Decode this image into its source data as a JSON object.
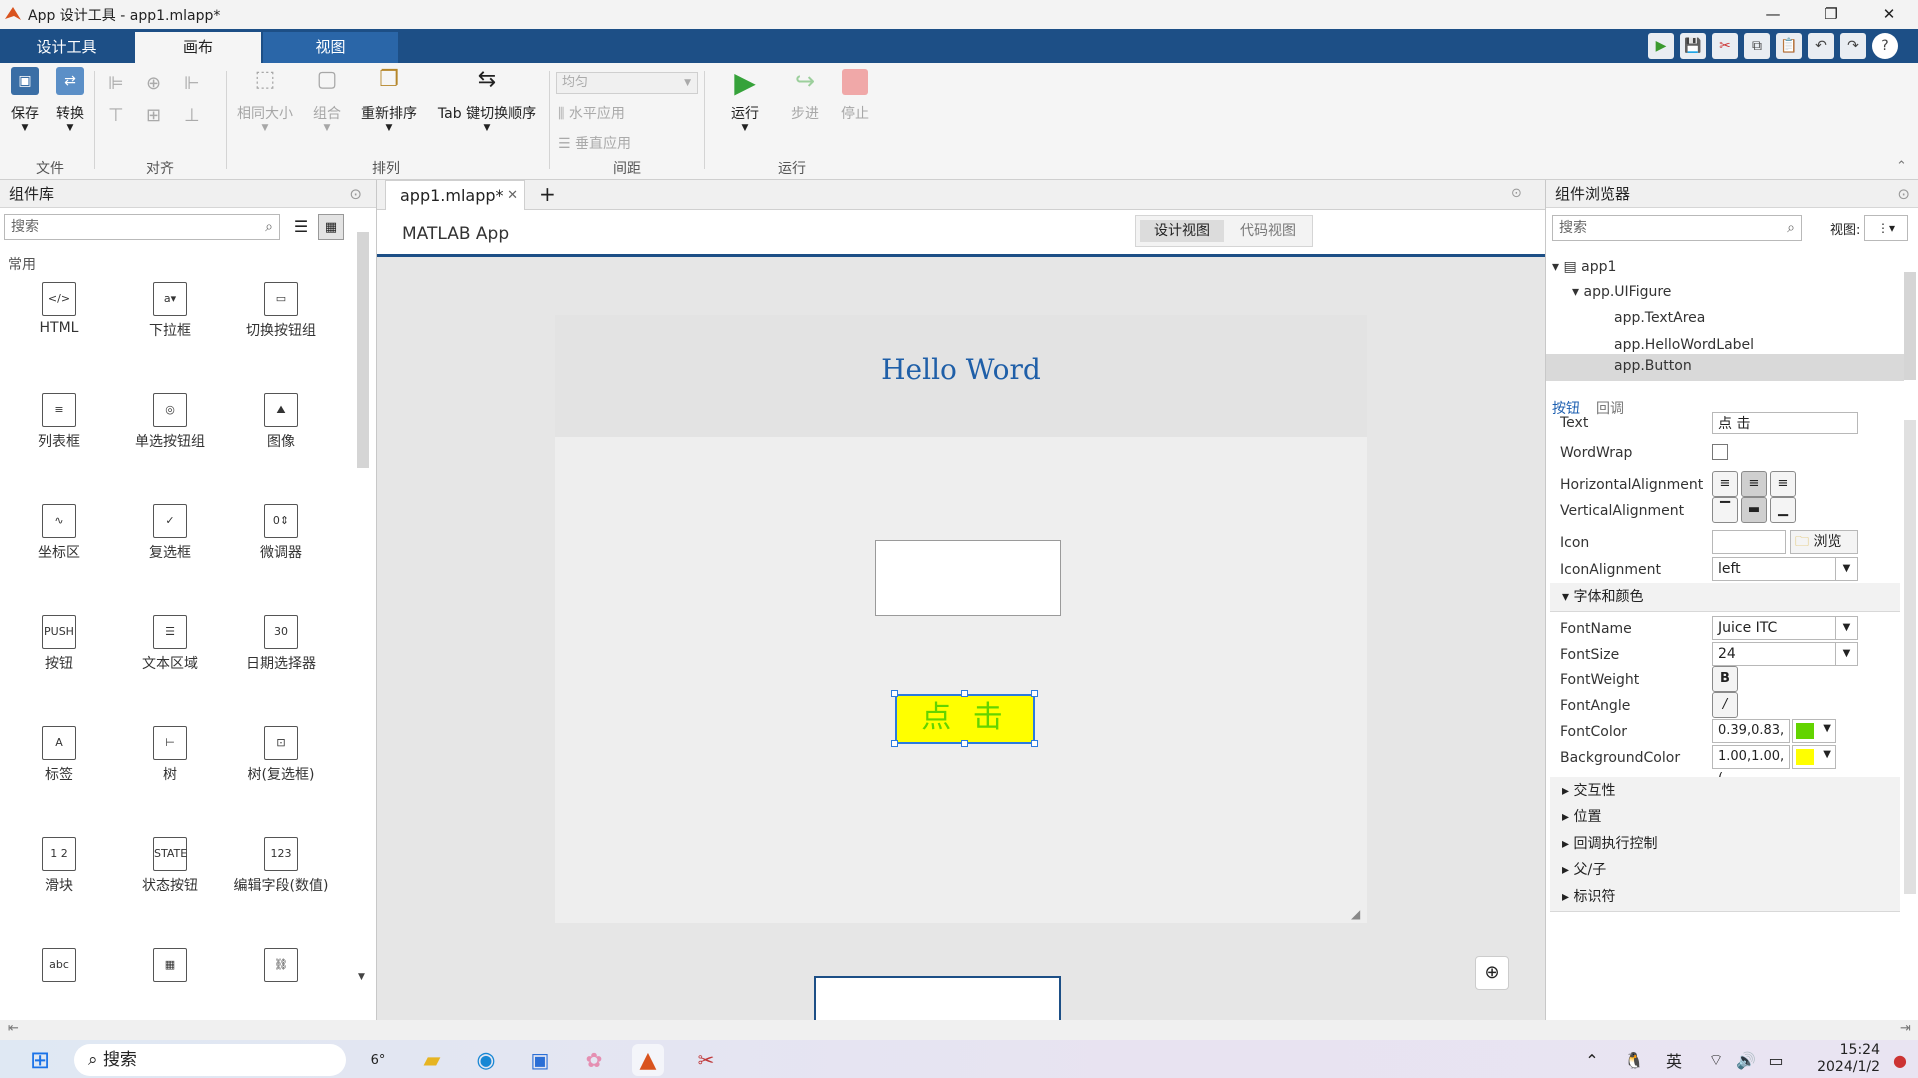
{
  "window": {
    "title": "App 设计工具 - app1.mlapp*"
  },
  "ribbon_tabs": [
    "设计工具",
    "画布",
    "视图"
  ],
  "ribbon": {
    "save": "保存",
    "convert": "转换",
    "same_size": "相同大小",
    "group": "组合",
    "reorder": "重新排序",
    "tab_order": "Tab 键切换顺序",
    "spacing_value": "均匀",
    "apply_h": "水平应用",
    "apply_v": "垂直应用",
    "run": "运行",
    "step": "步进",
    "stop": "停止",
    "groups": {
      "file": "文件",
      "align": "对齐",
      "arrange": "排列",
      "spacing": "间距",
      "run": "运行"
    }
  },
  "library": {
    "title": "组件库",
    "search_placeholder": "搜索",
    "section": "常用",
    "components": [
      {
        "label": "HTML",
        "icon": "html-icon",
        "glyph": "</>"
      },
      {
        "label": "下拉框",
        "icon": "dropdown-icon",
        "glyph": "a▾"
      },
      {
        "label": "切换按钮组",
        "icon": "toggle-group-icon",
        "glyph": "▭"
      },
      {
        "label": "列表框",
        "icon": "listbox-icon",
        "glyph": "≡"
      },
      {
        "label": "单选按钮组",
        "icon": "radio-group-icon",
        "glyph": "◎"
      },
      {
        "label": "图像",
        "icon": "image-icon",
        "glyph": "⛰"
      },
      {
        "label": "坐标区",
        "icon": "axes-icon",
        "glyph": "∿"
      },
      {
        "label": "复选框",
        "icon": "checkbox-icon",
        "glyph": "✓"
      },
      {
        "label": "微调器",
        "icon": "spinner-icon",
        "glyph": "0⇕"
      },
      {
        "label": "按钮",
        "icon": "push-button-icon",
        "glyph": "PUSH"
      },
      {
        "label": "文本区域",
        "icon": "text-area-icon",
        "glyph": "☰"
      },
      {
        "label": "日期选择器",
        "icon": "date-picker-icon",
        "glyph": "30"
      },
      {
        "label": "标签",
        "icon": "label-icon",
        "glyph": "A"
      },
      {
        "label": "树",
        "icon": "tree-icon",
        "glyph": "⊢"
      },
      {
        "label": "树(复选框)",
        "icon": "checkbox-tree-icon",
        "glyph": "⊡"
      },
      {
        "label": "滑块",
        "icon": "slider-icon",
        "glyph": "1 2"
      },
      {
        "label": "状态按钮",
        "icon": "state-button-icon",
        "glyph": "STATE"
      },
      {
        "label": "编辑字段(数值)",
        "icon": "numeric-field-icon",
        "glyph": "123"
      },
      {
        "label": "",
        "icon": "text-field-icon",
        "glyph": "abc"
      },
      {
        "label": "",
        "icon": "table-icon",
        "glyph": "▦"
      },
      {
        "label": "",
        "icon": "hyperlink-icon",
        "glyph": "⛓"
      }
    ]
  },
  "editor": {
    "tab": "app1.mlapp*",
    "app_title": "MATLAB App",
    "design_view": "设计视图",
    "code_view": "代码视图",
    "label_text": "Hello Word",
    "button_text": "点  击"
  },
  "browser": {
    "title": "组件浏览器",
    "search_placeholder": "搜索",
    "view_label": "视图:",
    "tree": [
      "app1",
      "app.UIFigure",
      "app.TextArea",
      "app.HelloWordLabel",
      "app.Button"
    ],
    "tabs": [
      "按钮",
      "回调"
    ],
    "props": {
      "Text": "点  击",
      "WordWrap": "WordWrap",
      "HorizontalAlignment": "HorizontalAlignment",
      "VerticalAlignment": "VerticalAlignment",
      "Icon": "Icon",
      "browse": "浏览",
      "IconAlignment": "IconAlignment",
      "icon_alignment_value": "left",
      "section_font": "字体和颜色",
      "FontName": "FontName",
      "font_name_value": "Juice ITC",
      "FontSize": "FontSize",
      "font_size_value": "24",
      "FontWeight": "FontWeight",
      "FontAngle": "FontAngle",
      "FontColor": "FontColor",
      "font_color_value": "0.39,0.83,(",
      "BackgroundColor": "BackgroundColor",
      "bg_color_value": "1.00,1.00,(",
      "text_label": "Text"
    },
    "sections": [
      "交互性",
      "位置",
      "回调执行控制",
      "父/子",
      "标识符"
    ]
  },
  "taskbar": {
    "search": "搜索",
    "weather": "6°",
    "ime": "英",
    "time": "15:24",
    "date": "2024/1/2"
  },
  "colors": {
    "accent": "#1d4f86",
    "button_bg": "#ffff00",
    "button_fg": "#63d400",
    "label": "#1f5fa8"
  }
}
